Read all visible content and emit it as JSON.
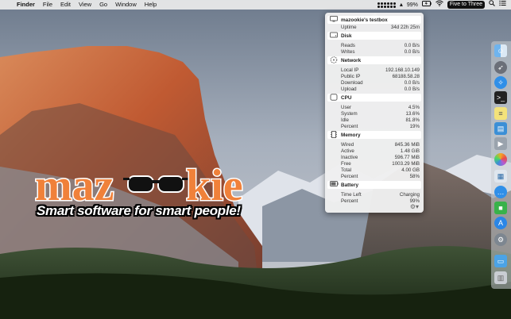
{
  "menubar": {
    "apple": "",
    "app": "Finder",
    "menus": [
      "File",
      "Edit",
      "View",
      "Go",
      "Window",
      "Help"
    ],
    "battery": "99%",
    "clock": "Five to Three"
  },
  "brand": {
    "logo_text": "mazookie",
    "tagline": "Smart software for smart people!"
  },
  "popup": {
    "title": "mazookie's testbox",
    "uptime_label": "Uptime",
    "uptime_value": "34d 22h 25m",
    "disk": {
      "title": "Disk",
      "rows": [
        {
          "label": "Reads",
          "value": "0.0 B/s"
        },
        {
          "label": "Writes",
          "value": "0.0 B/s"
        }
      ]
    },
    "network": {
      "title": "Network",
      "rows": [
        {
          "label": "Local IP",
          "value": "192.168.10.149"
        },
        {
          "label": "Public IP",
          "value": "68188.58.28"
        },
        {
          "label": "Download",
          "value": "0.0 B/s"
        },
        {
          "label": "Upload",
          "value": "0.0 B/s"
        }
      ]
    },
    "cpu": {
      "title": "CPU",
      "rows": [
        {
          "label": "User",
          "value": "4.5%"
        },
        {
          "label": "System",
          "value": "13.6%"
        },
        {
          "label": "Idle",
          "value": "81.8%"
        },
        {
          "label": "Percent",
          "value": "19%"
        }
      ]
    },
    "memory": {
      "title": "Memory",
      "rows": [
        {
          "label": "Wired",
          "value": "845.36 MiB"
        },
        {
          "label": "Active",
          "value": "1.48 GiB"
        },
        {
          "label": "Inactive",
          "value": "596.77 MiB"
        },
        {
          "label": "Free",
          "value": "1003.29 MiB"
        },
        {
          "label": "Total",
          "value": "4.00 GB"
        },
        {
          "label": "Percent",
          "value": "58%"
        }
      ]
    },
    "battery": {
      "title": "Battery",
      "rows": [
        {
          "label": "Time Left",
          "value": "Charging"
        },
        {
          "label": "Percent",
          "value": "99%"
        }
      ]
    }
  },
  "dock": {
    "apps": [
      "finder-icon",
      "rocket-icon",
      "safari-icon",
      "terminal-icon",
      "notes-icon",
      "preview-icon",
      "photos-icon",
      "image-capture-icon",
      "messages-icon",
      "facetime-icon",
      "app-store-icon",
      "system-preferences-icon",
      "folder-icon",
      "trash-icon"
    ]
  }
}
